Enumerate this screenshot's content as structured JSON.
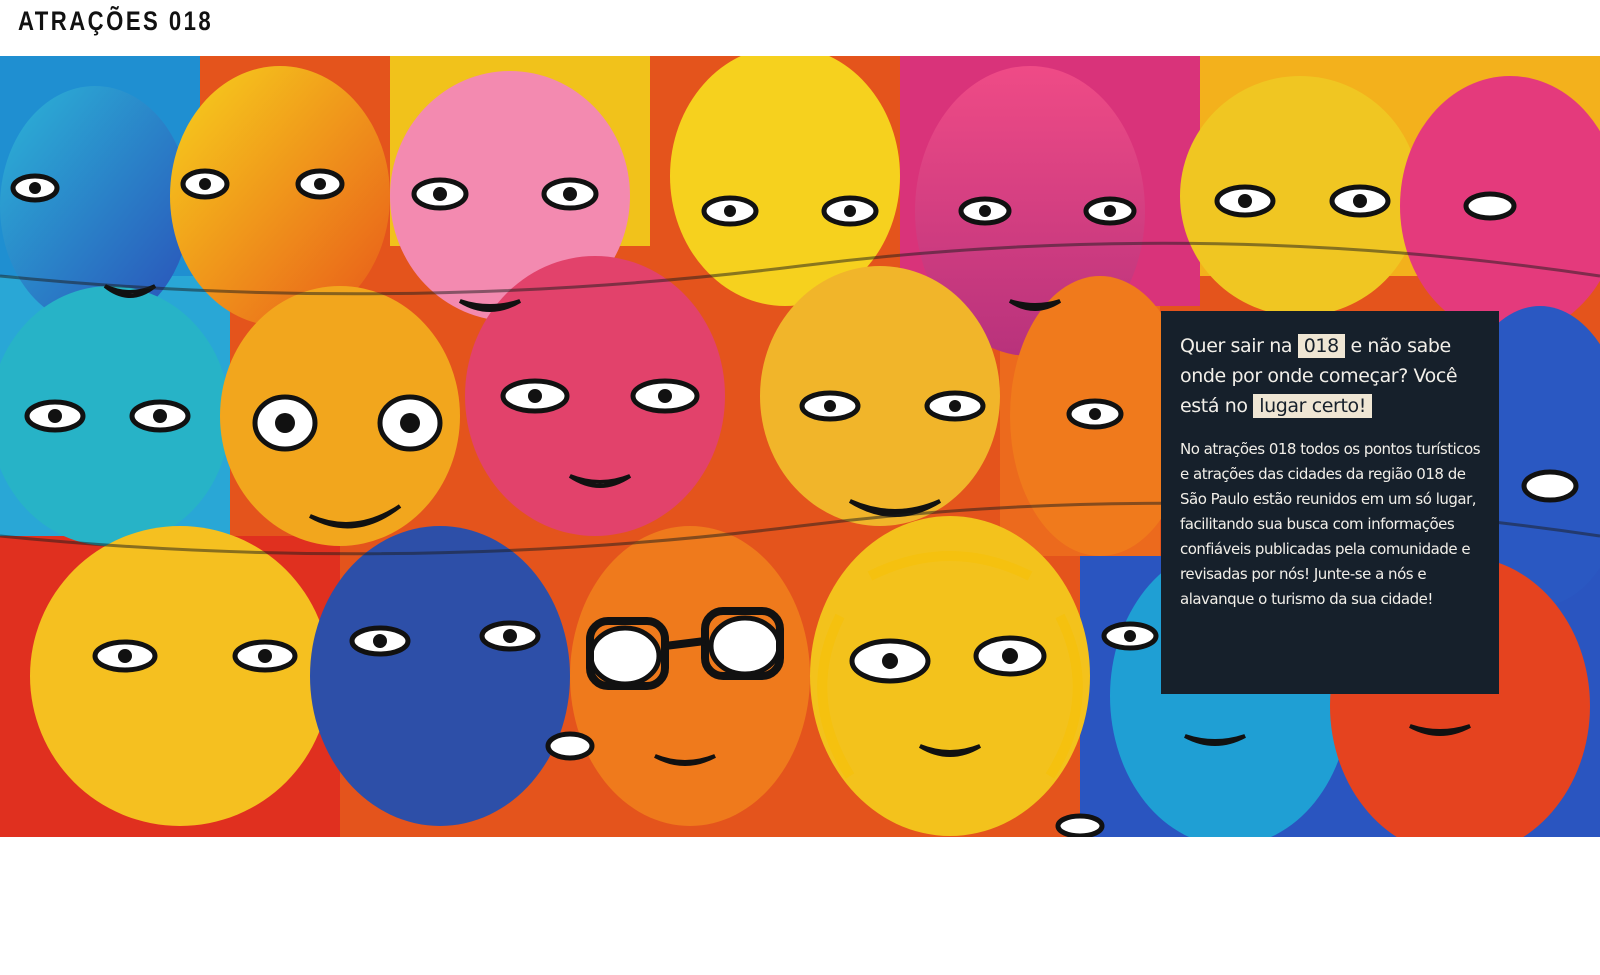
{
  "header": {
    "brand": "ATRAÇÕES 018"
  },
  "hero": {
    "image": "colorful graffiti mural of stylized faces",
    "info": {
      "headline_part1": "Quer sair na ",
      "headline_pill1": "018",
      "headline_part2": " e não sabe onde por onde começar? Você está no ",
      "headline_pill2": "lugar certo!",
      "body": "No atrações 018 todos os pontos turísticos e atrações das cidades da região 018 de São Paulo estão reunidos em um só lugar, facilitando sua busca com informações confiáveis publicadas pela comunidade e revisadas por nós! Junte-se a nós e alavanque o turismo da sua cidade!"
    }
  },
  "colors": {
    "panel": "#16202b",
    "pill": "#efe6d4",
    "text_light": "#f2efe9"
  }
}
